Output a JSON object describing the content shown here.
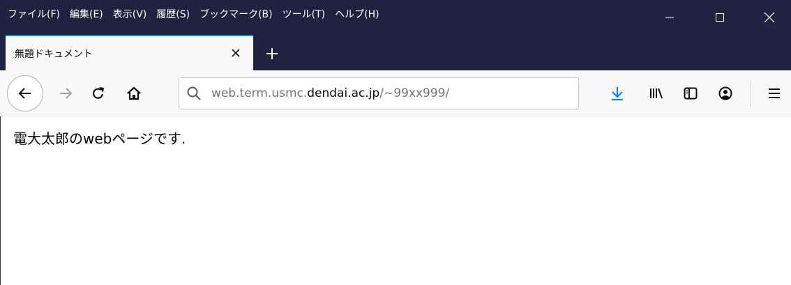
{
  "menu": {
    "items": [
      "ファイル(F)",
      "編集(E)",
      "表示(V)",
      "履歴(S)",
      "ブックマーク(B)",
      "ツール(T)",
      "ヘルプ(H)"
    ]
  },
  "window_controls": {
    "minimize_icon": "minimize-icon",
    "maximize_icon": "maximize-icon",
    "close_icon": "close-icon"
  },
  "tab": {
    "title": "無題ドキュメント"
  },
  "urlbar": {
    "prefix": "web.term.usmc.",
    "domain": "dendai.ac.jp",
    "path": "/~99xx999/"
  },
  "content": {
    "text": "電大太郎のwebページです."
  },
  "colors": {
    "titlebar": "#202340",
    "toolbar": "#f9f9fa",
    "accent": "#0a84ff"
  }
}
